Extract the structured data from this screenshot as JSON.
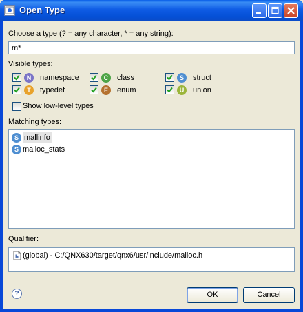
{
  "window": {
    "title": "Open Type"
  },
  "pattern": {
    "label": "Choose a type (? = any character, * = any string):",
    "value": "m*"
  },
  "visible_types": {
    "label": "Visible types:",
    "items": [
      {
        "label": "namespace",
        "checked": true,
        "glyph": "N",
        "color": "#7B74C7",
        "icon": "namespace-icon"
      },
      {
        "label": "class",
        "checked": true,
        "glyph": "C",
        "color": "#4FA548",
        "icon": "class-icon"
      },
      {
        "label": "struct",
        "checked": true,
        "glyph": "S",
        "color": "#4E8ED1",
        "icon": "struct-icon"
      },
      {
        "label": "typedef",
        "checked": true,
        "glyph": "T",
        "color": "#E8A22B",
        "icon": "typedef-icon"
      },
      {
        "label": "enum",
        "checked": true,
        "glyph": "E",
        "color": "#B5722F",
        "icon": "enum-icon"
      },
      {
        "label": "union",
        "checked": true,
        "glyph": "U",
        "color": "#9BB53A",
        "icon": "union-icon"
      }
    ],
    "low_level_label": "Show low-level types",
    "low_level_checked": false
  },
  "matching": {
    "label": "Matching types:",
    "items": [
      {
        "name": "mallinfo",
        "glyph": "S",
        "selected": true
      },
      {
        "name": "malloc_stats",
        "glyph": "S",
        "selected": false
      }
    ]
  },
  "qualifier": {
    "label": "Qualifier:",
    "value": "(global) - C:/QNX630/target/qnx6/usr/include/malloc.h"
  },
  "buttons": {
    "ok": "OK",
    "cancel": "Cancel"
  },
  "colors": {
    "titlebar": "#0A5FE8",
    "dialog_bg": "#ECE9D8",
    "selection": "#E4E4E4",
    "struct_icon": "#4E8ED1"
  }
}
